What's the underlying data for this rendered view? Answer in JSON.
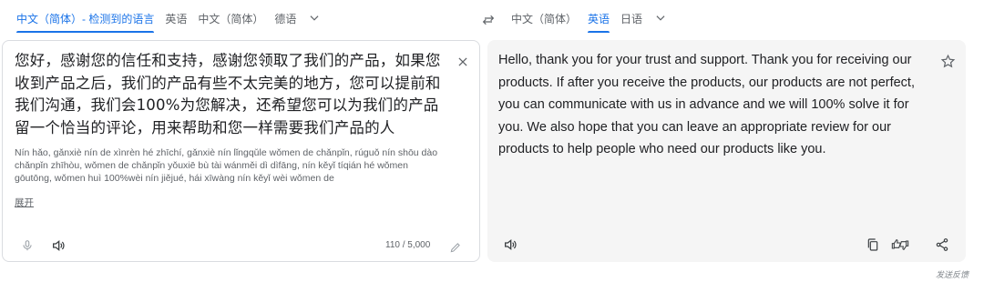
{
  "source_langbar": {
    "detected": "中文（简体）- 检测到的语言",
    "options": [
      "英语",
      "中文（简体）",
      "德语"
    ]
  },
  "target_langbar": {
    "options": [
      "中文（简体）",
      "英语",
      "日语"
    ],
    "active": "英语"
  },
  "source": {
    "text": "您好，感谢您的信任和支持，感谢您领取了我们的产品，如果您收到产品之后，我们的产品有些不太完美的地方，您可以提前和我们沟通，我们会100%为您解决，还希望您可以为我们的产品留一个恰当的评论，用来帮助和您一样需要我们产品的人",
    "romanization": "Nín hǎo, gǎnxiè nín de xìnrèn hé zhīchí, gǎnxiè nín lǐngqǔle wǒmen de chǎnpǐn, rúguǒ nín shōu dào chǎnpǐn zhīhòu, wǒmen de chǎnpǐn yǒuxiē bù tài wánměi dì dìfāng, nín kěyǐ tíqián hé wǒmen gōutōng, wǒmen huì 100%wèi nín jiějué, hái xīwàng nín kěyǐ wèi wǒmen de",
    "show_more": "展开",
    "char_count": "110 / 5,000"
  },
  "target": {
    "text": "Hello, thank you for your trust and support. Thank you for receiving our products. If after you receive the products, our products are not perfect, you can communicate with us in advance and we will 100% solve it for you. We also hope that you can leave an appropriate review for our products to help people who need our products like you."
  },
  "footer": {
    "feedback": "发送反馈"
  },
  "colors": {
    "accent": "#1a73e8",
    "icon": "#5f6368",
    "target_bg": "#f5f5f5",
    "border": "#dadce0"
  }
}
